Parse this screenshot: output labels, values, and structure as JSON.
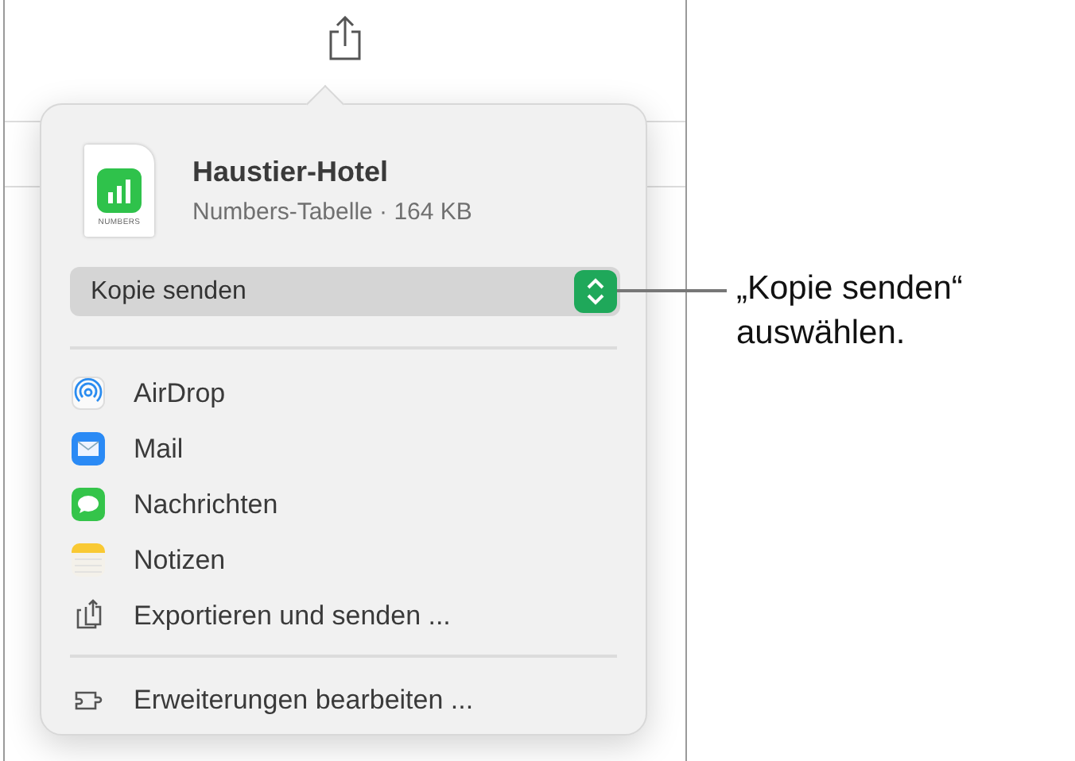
{
  "document": {
    "name": "Haustier-Hotel",
    "details": "Numbers-Tabelle · 164 KB",
    "badge": "NUMBERS"
  },
  "send_mode": {
    "value": "Kopie senden"
  },
  "share_items": [
    {
      "kind": "airdrop",
      "label": "AirDrop"
    },
    {
      "kind": "mail",
      "label": "Mail"
    },
    {
      "kind": "messages",
      "label": "Nachrichten"
    },
    {
      "kind": "notes",
      "label": "Notizen"
    },
    {
      "kind": "export",
      "label": "Exportieren und senden ..."
    }
  ],
  "footer_items": [
    {
      "kind": "extensions",
      "label": "Erweiterungen bearbeiten ..."
    }
  ],
  "callout": {
    "text": "„Kopie senden“ auswählen."
  }
}
